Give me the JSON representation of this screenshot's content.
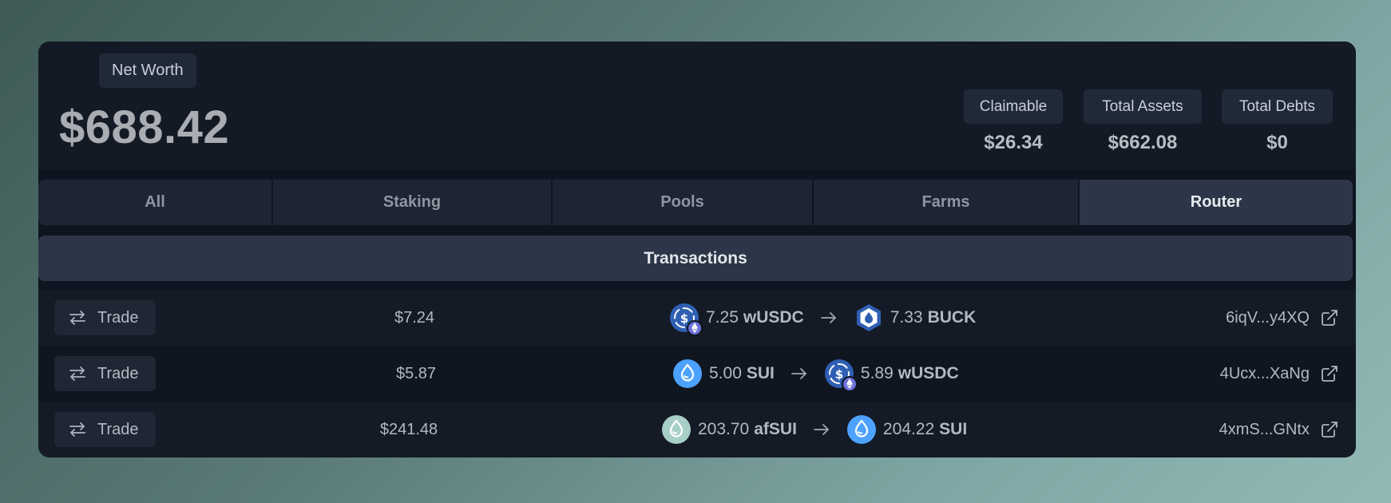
{
  "header": {
    "networth_label": "Net Worth",
    "networth_value": "$688.42",
    "stats": [
      {
        "label": "Claimable",
        "value": "$26.34"
      },
      {
        "label": "Total Assets",
        "value": "$662.08"
      },
      {
        "label": "Total Debts",
        "value": "$0"
      }
    ]
  },
  "tabs": [
    {
      "label": "All",
      "active": false
    },
    {
      "label": "Staking",
      "active": false
    },
    {
      "label": "Pools",
      "active": false
    },
    {
      "label": "Farms",
      "active": false
    },
    {
      "label": "Router",
      "active": true
    }
  ],
  "section": {
    "title": "Transactions"
  },
  "transactions": [
    {
      "type_label": "Trade",
      "type_icon": "swap-arrows-icon",
      "usd": "$7.24",
      "from": {
        "amount": "7.25",
        "symbol": "wUSDC",
        "icon": "wusdc-token-icon"
      },
      "to": {
        "amount": "7.33",
        "symbol": "BUCK",
        "icon": "buck-token-icon"
      },
      "hash": "6iqV...y4XQ",
      "link_icon": "external-link-icon"
    },
    {
      "type_label": "Trade",
      "type_icon": "swap-arrows-icon",
      "usd": "$5.87",
      "from": {
        "amount": "5.00",
        "symbol": "SUI",
        "icon": "sui-token-icon"
      },
      "to": {
        "amount": "5.89",
        "symbol": "wUSDC",
        "icon": "wusdc-token-icon"
      },
      "hash": "4Ucx...XaNg",
      "link_icon": "external-link-icon"
    },
    {
      "type_label": "Trade",
      "type_icon": "swap-arrows-icon",
      "usd": "$241.48",
      "from": {
        "amount": "203.70",
        "symbol": "afSUI",
        "icon": "afsui-token-icon"
      },
      "to": {
        "amount": "204.22",
        "symbol": "SUI",
        "icon": "sui-token-icon"
      },
      "hash": "4xmS...GNtx",
      "link_icon": "external-link-icon"
    }
  ],
  "colors": {
    "card_bg": "#0f1520",
    "active_tab": "#2c3648",
    "sui_blue": "#4da2ff",
    "wusdc_blue": "#2f5fb3"
  }
}
